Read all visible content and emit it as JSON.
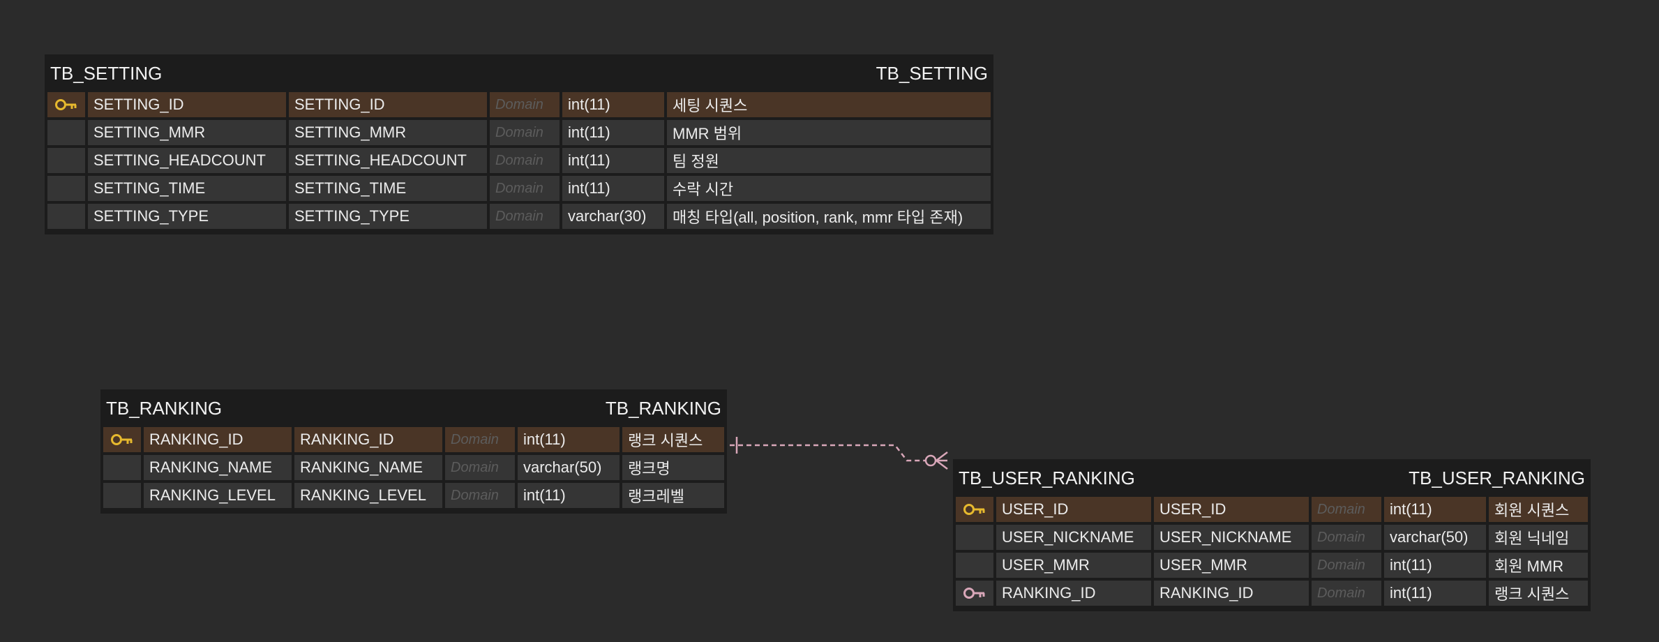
{
  "colors": {
    "background": "#2b2b2b",
    "entity_body": "#1c1c1c",
    "row": "#353535",
    "primary_key_row": "#4a3526",
    "primary_key_icon": "#e7b92e",
    "foreign_key_icon": "#d9a7b9",
    "relationship_line": "#d9a7b9"
  },
  "entities": {
    "setting": {
      "title_left": "TB_SETTING",
      "title_right": "TB_SETTING",
      "rows": [
        {
          "key": "pk",
          "logical": "SETTING_ID",
          "physical": "SETTING_ID",
          "domain": "Domain",
          "type": "int(11)",
          "comment": "세팅 시퀀스"
        },
        {
          "key": "",
          "logical": "SETTING_MMR",
          "physical": "SETTING_MMR",
          "domain": "Domain",
          "type": "int(11)",
          "comment": "MMR 범위"
        },
        {
          "key": "",
          "logical": "SETTING_HEADCOUNT",
          "physical": "SETTING_HEADCOUNT",
          "domain": "Domain",
          "type": "int(11)",
          "comment": "팀 정원"
        },
        {
          "key": "",
          "logical": "SETTING_TIME",
          "physical": "SETTING_TIME",
          "domain": "Domain",
          "type": "int(11)",
          "comment": "수락 시간"
        },
        {
          "key": "",
          "logical": "SETTING_TYPE",
          "physical": "SETTING_TYPE",
          "domain": "Domain",
          "type": "varchar(30)",
          "comment": "매칭 타입(all, position, rank, mmr 타입 존재)"
        }
      ]
    },
    "ranking": {
      "title_left": "TB_RANKING",
      "title_right": "TB_RANKING",
      "rows": [
        {
          "key": "pk",
          "logical": "RANKING_ID",
          "physical": "RANKING_ID",
          "domain": "Domain",
          "type": "int(11)",
          "comment": "랭크 시퀀스"
        },
        {
          "key": "",
          "logical": "RANKING_NAME",
          "physical": "RANKING_NAME",
          "domain": "Domain",
          "type": "varchar(50)",
          "comment": "랭크명"
        },
        {
          "key": "",
          "logical": "RANKING_LEVEL",
          "physical": "RANKING_LEVEL",
          "domain": "Domain",
          "type": "int(11)",
          "comment": "랭크레벨"
        }
      ]
    },
    "user_ranking": {
      "title_left": "TB_USER_RANKING",
      "title_right": "TB_USER_RANKING",
      "rows": [
        {
          "key": "pk",
          "logical": "USER_ID",
          "physical": "USER_ID",
          "domain": "Domain",
          "type": "int(11)",
          "comment": "회원 시퀀스"
        },
        {
          "key": "",
          "logical": "USER_NICKNAME",
          "physical": "USER_NICKNAME",
          "domain": "Domain",
          "type": "varchar(50)",
          "comment": "회원 닉네임"
        },
        {
          "key": "",
          "logical": "USER_MMR",
          "physical": "USER_MMR",
          "domain": "Domain",
          "type": "int(11)",
          "comment": "회원 MMR"
        },
        {
          "key": "fk",
          "logical": "RANKING_ID",
          "physical": "RANKING_ID",
          "domain": "Domain",
          "type": "int(11)",
          "comment": "랭크 시퀀스"
        }
      ]
    }
  },
  "relationships": [
    {
      "from": "TB_RANKING",
      "to": "TB_USER_RANKING",
      "from_cardinality": "one",
      "to_cardinality": "zero-or-many",
      "style": "dashed"
    }
  ]
}
